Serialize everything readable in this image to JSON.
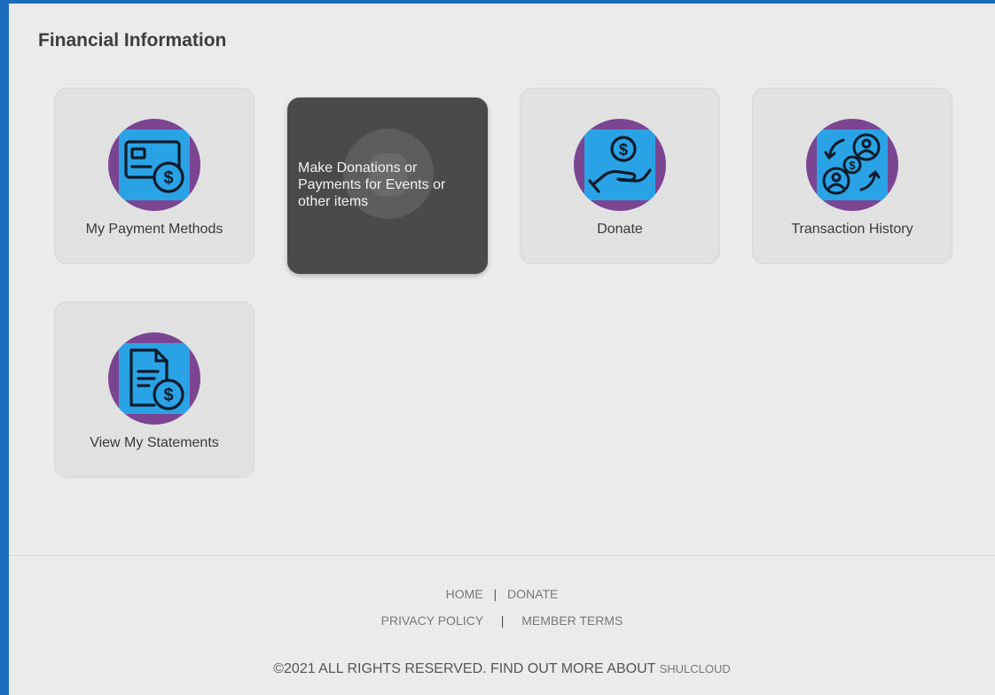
{
  "section_title": "Financial Information",
  "tiles": [
    {
      "label": "My Payment Methods",
      "icon": "payment-card-icon"
    },
    {
      "label": "Make Donations or Payments for Events or other items",
      "icon": "donation-heart-icon"
    },
    {
      "label": "Donate",
      "icon": "hand-coin-icon"
    },
    {
      "label": "Transaction History",
      "icon": "transaction-exchange-icon"
    },
    {
      "label": "View My Statements",
      "icon": "statement-document-icon"
    }
  ],
  "footer": {
    "home": "HOME",
    "donate": "DONATE",
    "separator": "|",
    "privacy": "PRIVACY POLICY",
    "terms": "MEMBER TERMS",
    "copyright": "©2021 ALL RIGHTS RESERVED. FIND OUT MORE ABOUT",
    "brand": "SHULCLOUD"
  },
  "colors": {
    "frame_border": "#1b6bbd",
    "background": "#ebebeb",
    "tile": "#e1e1e1",
    "tile_hover": "#4a4a4a",
    "icon_circle": "#7b4592",
    "icon_square": "#2aa3e6"
  }
}
